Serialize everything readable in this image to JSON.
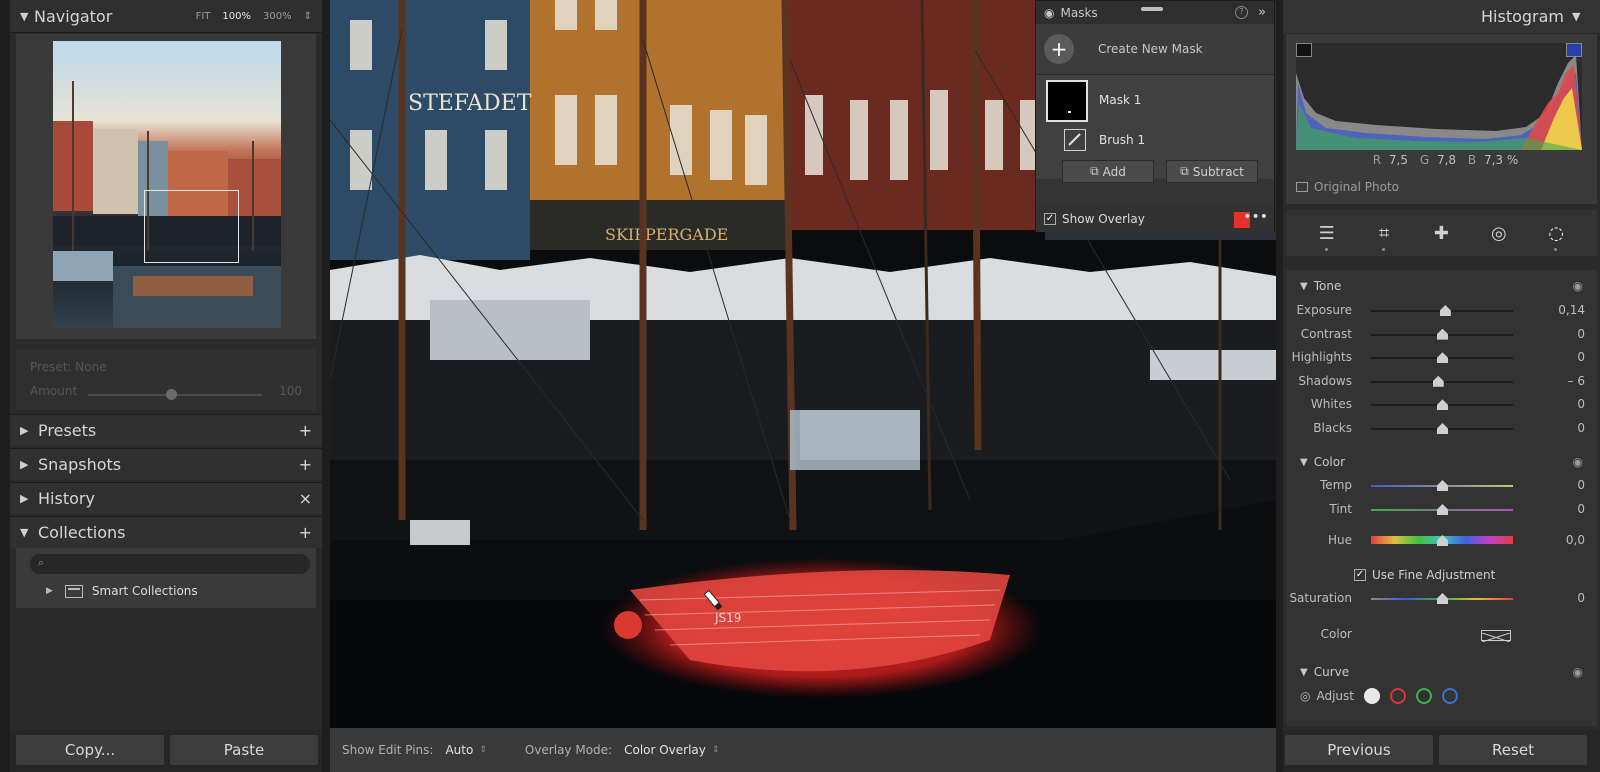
{
  "navigator": {
    "title": "Navigator",
    "zoom_options": [
      "FIT",
      "100%",
      "300%"
    ],
    "zoom_selected": "100%"
  },
  "preset_amount": {
    "preset_label": "Preset: None",
    "amount_label": "Amount",
    "amount_value": "100"
  },
  "left_sections": [
    {
      "label": "Presets",
      "action": "+"
    },
    {
      "label": "Snapshots",
      "action": "+"
    },
    {
      "label": "History",
      "action": "×"
    },
    {
      "label": "Collections",
      "action": "+"
    }
  ],
  "collections": {
    "search_placeholder": "",
    "smart_collections_label": "Smart Collections"
  },
  "left_buttons": {
    "copy": "Copy...",
    "paste": "Paste"
  },
  "center_bar": {
    "show_edit_pins_label": "Show Edit Pins:",
    "show_edit_pins_value": "Auto",
    "overlay_mode_label": "Overlay Mode:",
    "overlay_mode_value": "Color Overlay"
  },
  "masks_panel": {
    "title": "Masks",
    "create_new_mask": "Create New Mask",
    "mask_name": "Mask 1",
    "brush_name": "Brush 1",
    "add_label": "Add",
    "subtract_label": "Subtract",
    "show_overlay_label": "Show Overlay",
    "overlay_color": "#e4322b"
  },
  "histogram": {
    "title": "Histogram",
    "r_label": "R",
    "r_value": "7,5",
    "g_label": "G",
    "g_value": "7,8",
    "b_label": "B",
    "b_value": "7,3 %",
    "original_photo_label": "Original Photo"
  },
  "tools": [
    "sliders-icon",
    "crop-icon",
    "heal-icon",
    "redeye-icon",
    "mask-icon"
  ],
  "tone": {
    "title": "Tone",
    "sliders": [
      {
        "label": "Exposure",
        "value": "0,14",
        "position": 0.52
      },
      {
        "label": "Contrast",
        "value": "0",
        "position": 0.5
      },
      {
        "label": "Highlights",
        "value": "0",
        "position": 0.5
      },
      {
        "label": "Shadows",
        "value": "– 6",
        "position": 0.47
      },
      {
        "label": "Whites",
        "value": "0",
        "position": 0.5
      },
      {
        "label": "Blacks",
        "value": "0",
        "position": 0.5
      }
    ]
  },
  "color": {
    "title": "Color",
    "sliders": [
      {
        "label": "Temp",
        "value": "0",
        "position": 0.5
      },
      {
        "label": "Tint",
        "value": "0",
        "position": 0.5
      },
      {
        "label": "Hue",
        "value": "0,0",
        "position": 0.5
      }
    ],
    "fine_adjustment_label": "Use Fine Adjustment",
    "saturation": {
      "label": "Saturation",
      "value": "0",
      "position": 0.5
    },
    "color_label": "Color"
  },
  "curve": {
    "title": "Curve",
    "adjust_label": "Adjust",
    "channel_colors": [
      "#e8e8e8",
      "#d8343a",
      "#3fae49",
      "#3b6fd6"
    ]
  },
  "right_buttons": {
    "previous": "Previous",
    "reset": "Reset"
  }
}
